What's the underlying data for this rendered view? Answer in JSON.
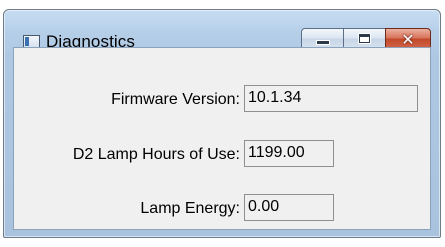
{
  "window": {
    "title": "Diagnostics"
  },
  "titlebar_icons": {
    "app": "app-window-icon",
    "minimize": "minimize-icon",
    "maximize": "maximize-icon",
    "close": "close-icon"
  },
  "fields": {
    "firmware_label": "Firmware Version:",
    "firmware_value": "10.1.34",
    "lamp_hours_label": "D2 Lamp Hours of Use:",
    "lamp_hours_value": "1199.00",
    "lamp_energy_label": "Lamp Energy:",
    "lamp_energy_value": "0.00"
  },
  "colors": {
    "close_button": "#c24a2b",
    "frame": "#b6cfe9",
    "client_background": "#f0f0f0"
  }
}
